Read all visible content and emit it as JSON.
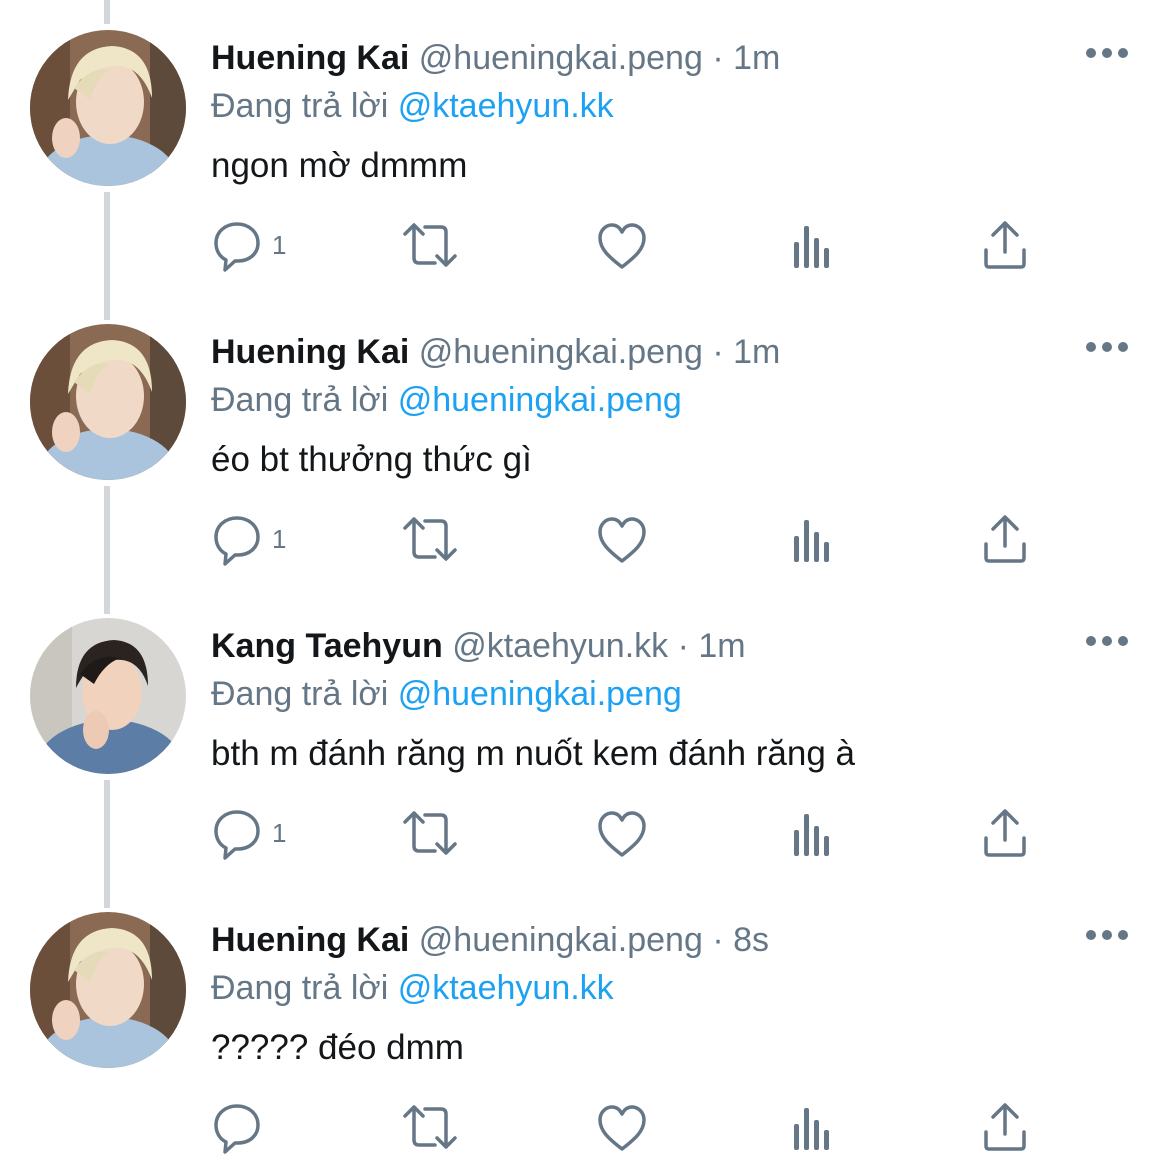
{
  "thread": {
    "replying_prefix": "Đang trả lời",
    "tweets": [
      {
        "author_name": "Huening Kai",
        "author_handle": "@hueningkai.peng",
        "separator": "·",
        "time": "1m",
        "reply_to": "@ktaehyun.kk",
        "text": "ngon mờ dmmm",
        "reply_count": "1",
        "avatar": "blonde-avatar"
      },
      {
        "author_name": "Huening Kai",
        "author_handle": "@hueningkai.peng",
        "separator": "·",
        "time": "1m",
        "reply_to": "@hueningkai.peng",
        "text": "éo bt thưởng thức gì",
        "reply_count": "1",
        "avatar": "blonde-avatar"
      },
      {
        "author_name": "Kang Taehyun",
        "author_handle": "@ktaehyun.kk",
        "separator": "·",
        "time": "1m",
        "reply_to": "@hueningkai.peng",
        "text": "bth m đánh răng m nuốt kem đánh răng à",
        "reply_count": "1",
        "avatar": "dark-hair-avatar"
      },
      {
        "author_name": "Huening Kai",
        "author_handle": "@hueningkai.peng",
        "separator": "·",
        "time": "8s",
        "reply_to": "@ktaehyun.kk",
        "text": "????? đéo dmm",
        "reply_count": "",
        "avatar": "blonde-avatar"
      }
    ]
  },
  "colors": {
    "text_primary": "#14171a",
    "text_secondary": "#657786",
    "mention": "#1da1f2",
    "thread_line": "#d3d7dc"
  },
  "icons": [
    "reply-icon",
    "retweet-icon",
    "like-icon",
    "analytics-icon",
    "share-icon",
    "more-icon"
  ]
}
